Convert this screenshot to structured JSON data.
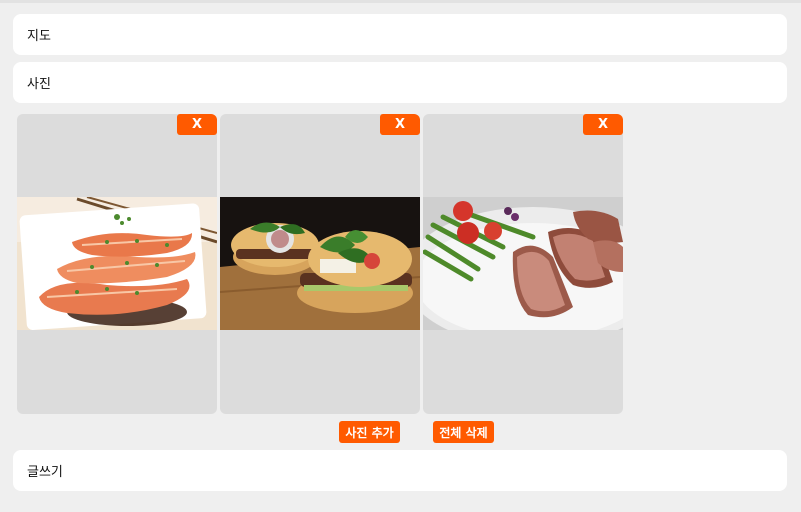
{
  "sections": {
    "map_label": "지도",
    "photo_label": "사진",
    "write_label": "글쓰기"
  },
  "photos": [
    {
      "name": "salmon-dish",
      "remove_label": "X"
    },
    {
      "name": "burgers",
      "remove_label": "X"
    },
    {
      "name": "steak-asparagus",
      "remove_label": "X"
    }
  ],
  "actions": {
    "add_photo_label": "사진 추가",
    "delete_all_label": "전체 삭제"
  },
  "colors": {
    "accent": "#ff5a00",
    "background": "#efefef",
    "card": "#ffffff",
    "photo_slot": "#dcdcdc"
  }
}
